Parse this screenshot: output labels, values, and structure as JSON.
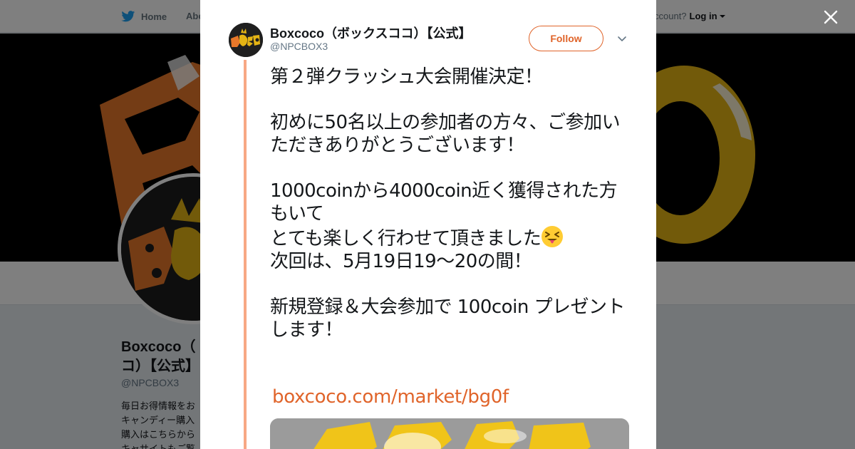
{
  "topnav": {
    "home_label": "Home",
    "about_label": "Abo",
    "account_prompt": "ccount?",
    "login_label": "Log in"
  },
  "background_profile": {
    "name": "Boxcoco（ボックスココ）【公式】",
    "name_visible": "Boxcoco（ ココ）【公式】",
    "handle": "@NPCBOX3",
    "bio_lines": [
      "毎日お得情報をお",
      "キャンディー購入",
      "購入はこちらから",
      "キャサイトもご覧"
    ]
  },
  "modal": {
    "author_name": "Boxcoco（ボックスココ）【公式】",
    "author_handle": "@NPCBOX3",
    "follow_label": "Follow",
    "tweet_text": "第２弾クラッシュ大会開催決定！\n\n初めに50名以上の参加者の方々、ご参加いただきありがとうございます！\n\n1000coinから4000coin近く獲得された方もいて\nとても楽しく行わせて頂きました",
    "tweet_text_2": "\n次回は、5月19日19〜20の間！\n\n新規登録＆大会参加で 100coin プレゼントします！",
    "link_text": "boxcoco.com/market/bg0f"
  },
  "icons": {
    "bird": "twitter-bird-icon",
    "close": "close-icon",
    "chevron": "chevron-down-icon",
    "emoji": "squinting-face-with-tongue-emoji"
  },
  "colors": {
    "accent": "#e0642a",
    "thread_line": "#f7a884",
    "twitter_blue": "#1da1f2"
  }
}
